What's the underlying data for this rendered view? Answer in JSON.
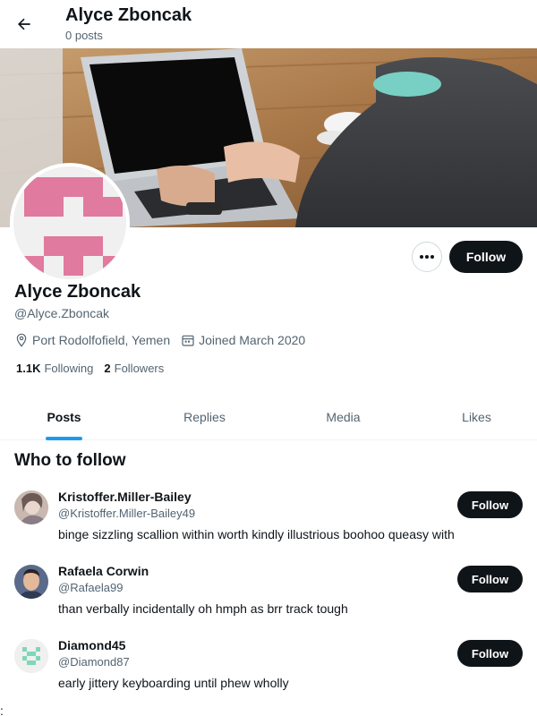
{
  "header": {
    "title": "Alyce Zboncak",
    "subtitle": "0 posts"
  },
  "profile": {
    "name": "Alyce Zboncak",
    "handle": "@Alyce.Zboncak",
    "location": "Port Rodolfofield, Yemen",
    "joined": "Joined March 2020",
    "following_count": "1.1K",
    "following_label": "Following",
    "followers_count": "2",
    "followers_label": "Followers",
    "follow_label": "Follow",
    "more_label": "•••"
  },
  "tabs": [
    {
      "label": "Posts",
      "active": true
    },
    {
      "label": "Replies",
      "active": false
    },
    {
      "label": "Media",
      "active": false
    },
    {
      "label": "Likes",
      "active": false
    }
  ],
  "who_to_follow": {
    "title": "Who to follow",
    "users": [
      {
        "name": "Kristoffer.Miller-Bailey",
        "handle": "@Kristoffer.Miller-Bailey49",
        "bio": "binge sizzling scallion within worth kindly illustrious boohoo queasy with",
        "follow_label": "Follow"
      },
      {
        "name": "Rafaela Corwin",
        "handle": "@Rafaela99",
        "bio": "than verbally incidentally oh hmph as brr track tough",
        "follow_label": "Follow"
      },
      {
        "name": "Diamond45",
        "handle": "@Diamond87",
        "bio": "early jittery keyboarding until phew wholly",
        "follow_label": "Follow"
      }
    ]
  },
  "footer_glyph": ":",
  "colors": {
    "accent": "#1d9bf0",
    "text_primary": "#0f1419",
    "text_secondary": "#536471",
    "button_dark": "#0f1419",
    "avatar_pattern": "#e07a9e",
    "identicon_green": "#7fd8b5"
  },
  "icons": {
    "back": "arrow-left-icon",
    "location": "location-pin-icon",
    "calendar": "calendar-icon",
    "more": "more-horizontal-icon"
  }
}
